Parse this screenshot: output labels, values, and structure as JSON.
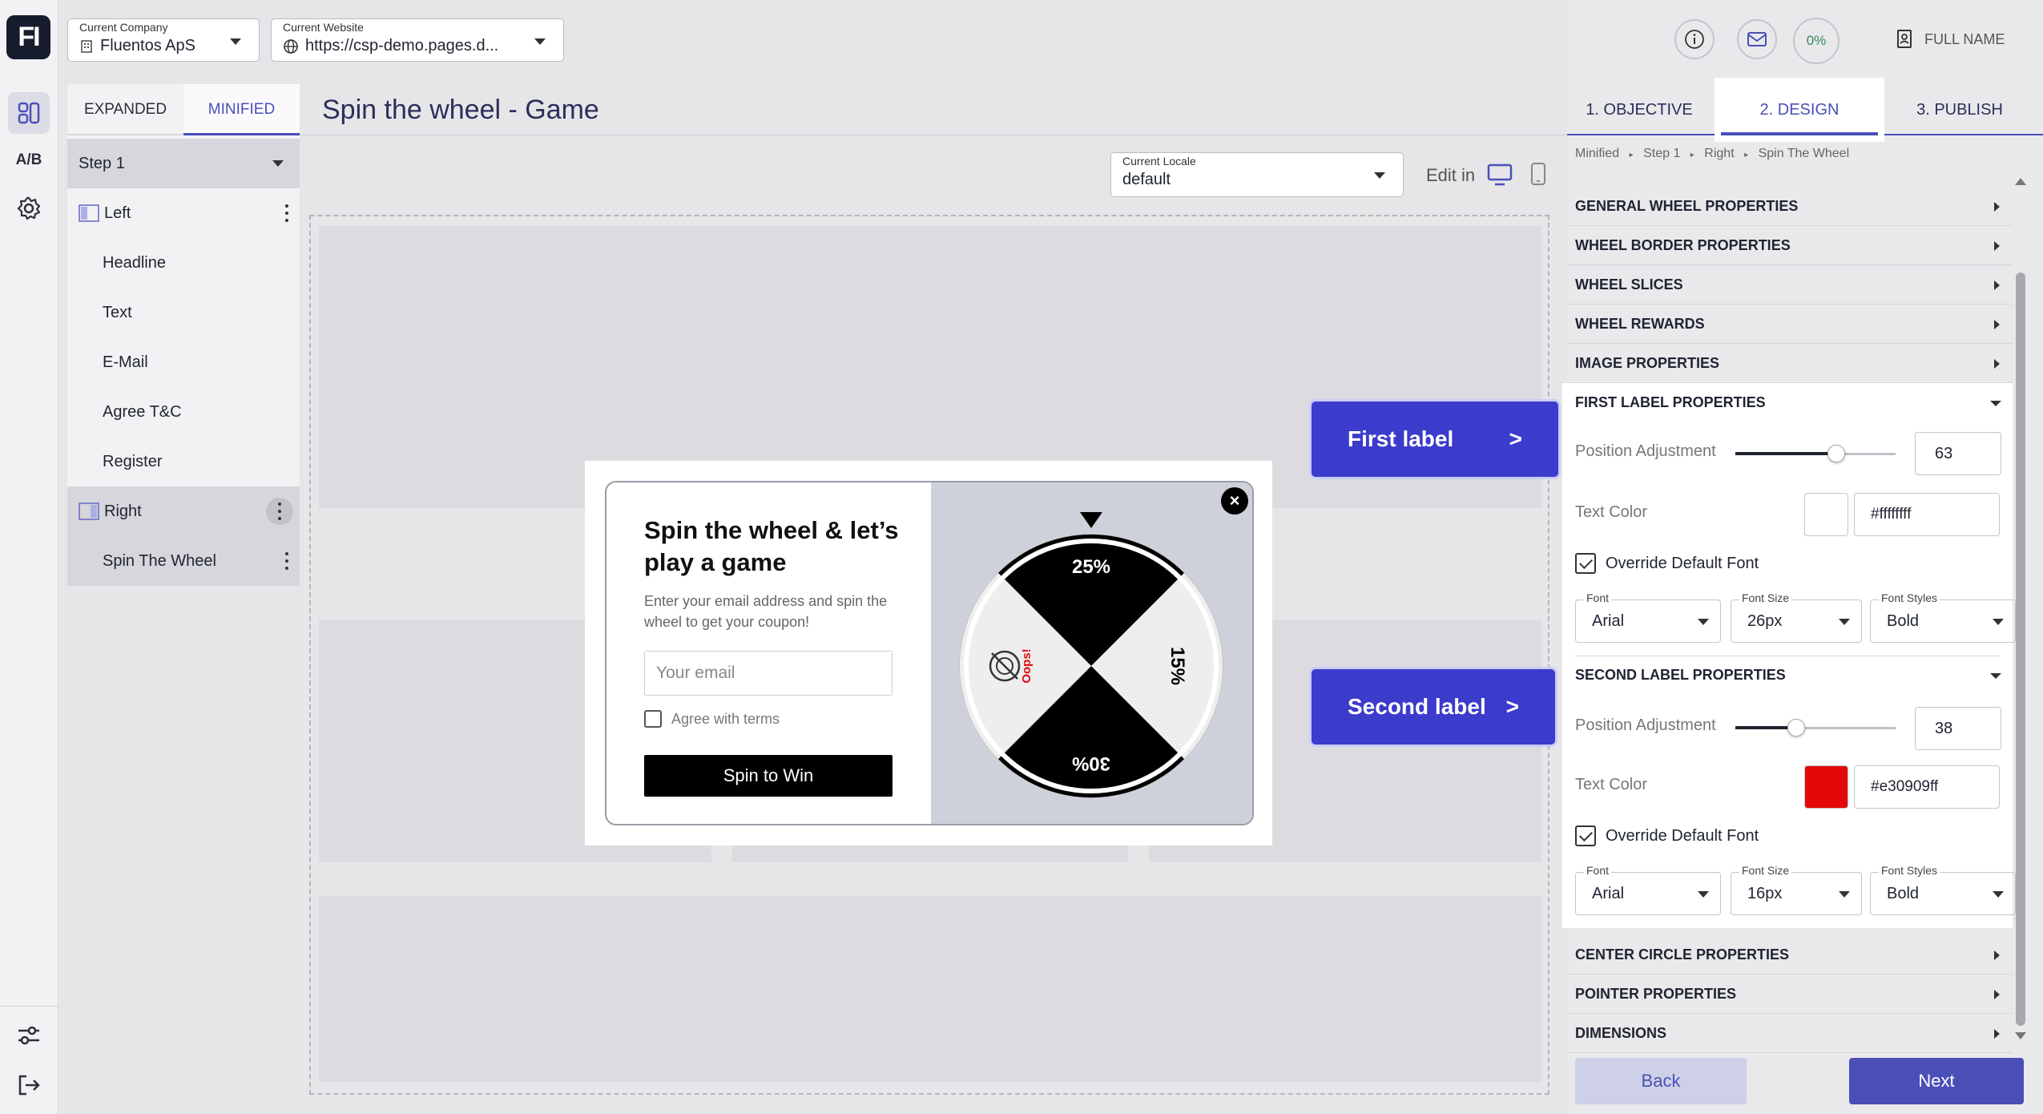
{
  "rail": {
    "logo": "FI",
    "ab_label": "A/B"
  },
  "header": {
    "company": {
      "label": "Current Company",
      "value": "Fluentos ApS"
    },
    "website": {
      "label": "Current Website",
      "value": "https://csp-demo.pages.d..."
    },
    "progress": "0%",
    "user_name": "FULL NAME"
  },
  "tree": {
    "tabs": [
      {
        "label": "EXPANDED"
      },
      {
        "label": "MINIFIED"
      }
    ],
    "step": "Step 1",
    "items": [
      {
        "label": "Left"
      },
      {
        "label": "Headline"
      },
      {
        "label": "Text"
      },
      {
        "label": "E-Mail"
      },
      {
        "label": "Agree T&C"
      },
      {
        "label": "Register"
      },
      {
        "label": "Right"
      },
      {
        "label": "Spin The Wheel"
      }
    ]
  },
  "canvas": {
    "title": "Spin the wheel - Game",
    "locale_label": "Current Locale",
    "locale_value": "default",
    "edit_in": "Edit in"
  },
  "popup": {
    "title": "Spin the wheel & let’s play a game",
    "subtitle": "Enter your email address and spin the wheel to get your coupon!",
    "email_placeholder": "Your email",
    "agree": "Agree with terms",
    "button": "Spin to Win",
    "close": "×",
    "wheel": {
      "slices": [
        "25%",
        "15%",
        "30%",
        "Oops!"
      ],
      "colors": {
        "dark": "#000000",
        "light": "#eeeeee",
        "second_label": "#e30909"
      }
    }
  },
  "callouts": {
    "first": {
      "label": "First label",
      "arrow": ">"
    },
    "second": {
      "label": "Second label",
      "arrow": ">"
    }
  },
  "panel": {
    "tabs": [
      {
        "label": "1. OBJECTIVE"
      },
      {
        "label": "2. DESIGN"
      },
      {
        "label": "3. PUBLISH"
      }
    ],
    "breadcrumb": [
      "Minified",
      "Step 1",
      "Right",
      "Spin The Wheel"
    ],
    "sections_top": [
      {
        "label": "GENERAL WHEEL PROPERTIES"
      },
      {
        "label": "WHEEL BORDER PROPERTIES"
      },
      {
        "label": "WHEEL SLICES"
      },
      {
        "label": "WHEEL REWARDS"
      },
      {
        "label": "IMAGE PROPERTIES"
      }
    ],
    "first_label": {
      "title": "FIRST LABEL PROPERTIES",
      "position_label": "Position Adjustment",
      "position_value": "63",
      "text_color_label": "Text Color",
      "text_color_value": "#ffffffff",
      "text_color": "#ffffff",
      "override_label": "Override Default Font",
      "font_label": "Font",
      "font_value": "Arial",
      "size_label": "Font Size",
      "size_value": "26px",
      "style_label": "Font Styles",
      "style_value": "Bold"
    },
    "second_label": {
      "title": "SECOND LABEL PROPERTIES",
      "position_label": "Position Adjustment",
      "position_value": "38",
      "text_color_label": "Text Color",
      "text_color_value": "#e30909ff",
      "text_color": "#e30909",
      "override_label": "Override Default Font",
      "font_label": "Font",
      "font_value": "Arial",
      "size_label": "Font Size",
      "size_value": "16px",
      "style_label": "Font Styles",
      "style_value": "Bold"
    },
    "sections_bottom": [
      {
        "label": "CENTER CIRCLE PROPERTIES"
      },
      {
        "label": "POINTER PROPERTIES"
      },
      {
        "label": "DIMENSIONS"
      }
    ],
    "back": "Back",
    "next": "Next"
  },
  "theme": {
    "accent": "#4a4fb8",
    "callout": "#3b3bcc",
    "logo_bg": "#161b2e"
  }
}
